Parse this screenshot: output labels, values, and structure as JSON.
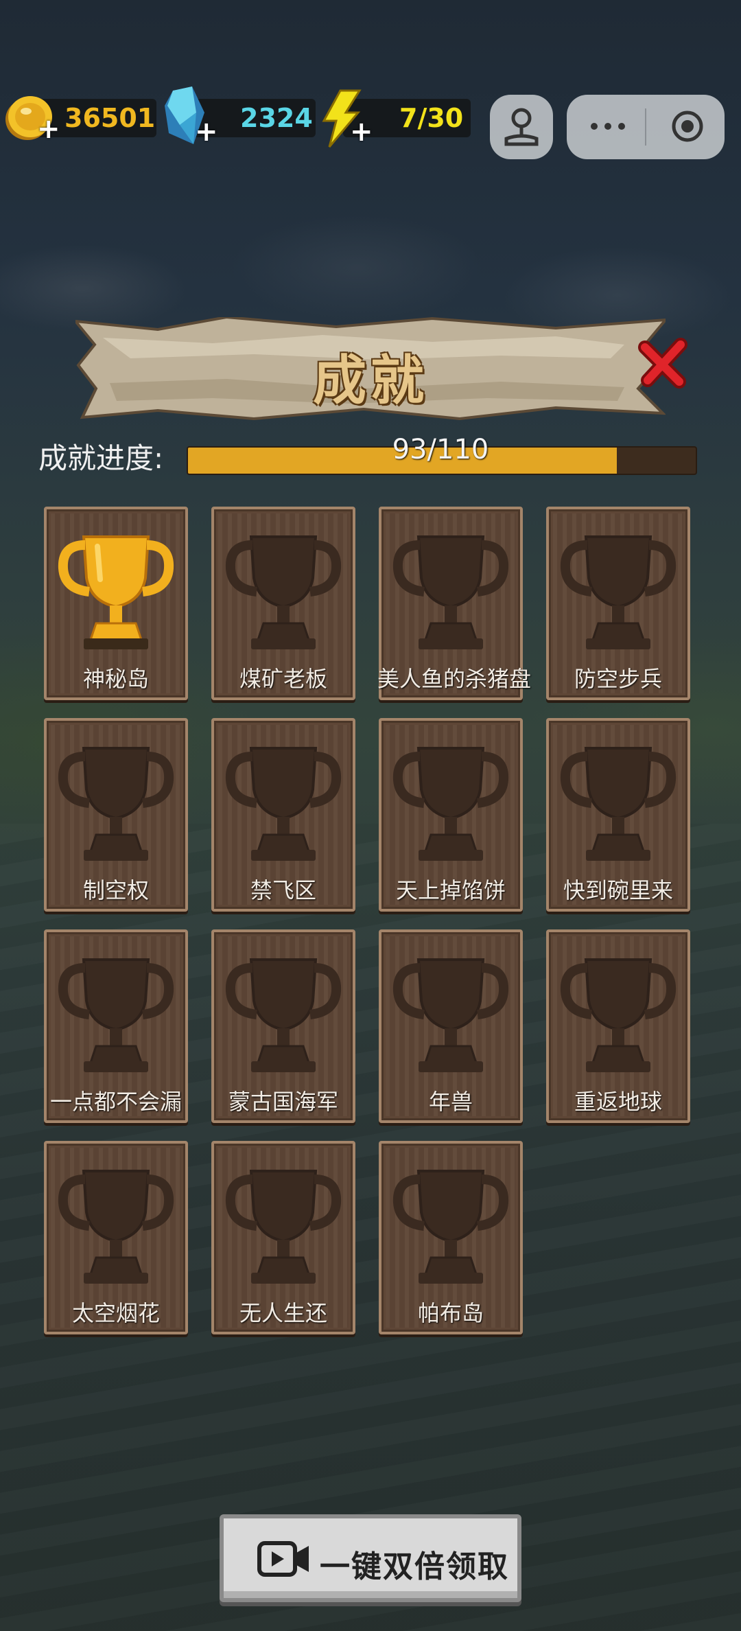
{
  "resources": {
    "coins": "36501",
    "gems": "2324",
    "energy": "7/30"
  },
  "header": {
    "title": "成就"
  },
  "progress": {
    "label": "成就进度:",
    "text": "93/110",
    "fraction": 0.845
  },
  "achievements": [
    {
      "label": "神秘岛",
      "unlocked": true
    },
    {
      "label": "煤矿老板",
      "unlocked": false
    },
    {
      "label": "美人鱼的杀猪盘",
      "unlocked": false
    },
    {
      "label": "防空步兵",
      "unlocked": false
    },
    {
      "label": "制空权",
      "unlocked": false
    },
    {
      "label": "禁飞区",
      "unlocked": false
    },
    {
      "label": "天上掉馅饼",
      "unlocked": false
    },
    {
      "label": "快到碗里来",
      "unlocked": false
    },
    {
      "label": "一点都不会漏",
      "unlocked": false
    },
    {
      "label": "蒙古国海军",
      "unlocked": false
    },
    {
      "label": "年兽",
      "unlocked": false
    },
    {
      "label": "重返地球",
      "unlocked": false
    },
    {
      "label": "太空烟花",
      "unlocked": false
    },
    {
      "label": "无人生还",
      "unlocked": false
    },
    {
      "label": "帕布岛",
      "unlocked": false
    }
  ],
  "claim_button": {
    "label": "一键双倍领取",
    "icon": "video-camera-icon"
  },
  "colors": {
    "coin": "#f0b820",
    "gem": "#5ad6e6",
    "energy": "#f2e21a",
    "progress_fill": "#e2a624",
    "trophy_gold": "#f2b01e",
    "trophy_locked": "#3a2a20",
    "close_red": "#e0242a"
  }
}
